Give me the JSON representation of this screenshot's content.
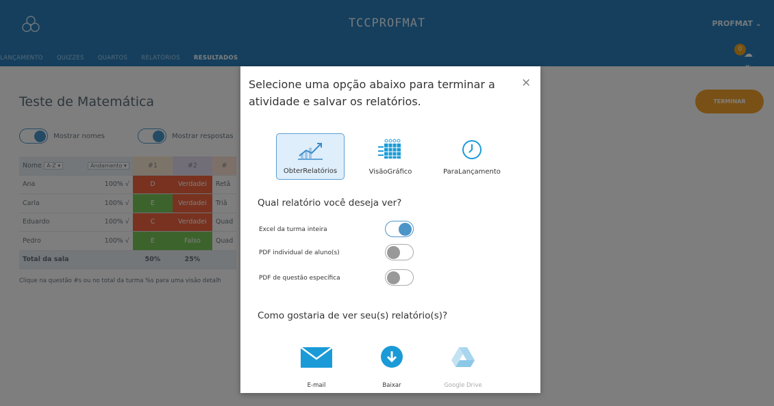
{
  "app": {
    "title": "TCCPROFMAT",
    "user": "PROFMAT ⌄"
  },
  "nav": {
    "items": [
      "LANÇAMENTO",
      "QUIZZES",
      "QUARTOS",
      "RELATÓRIOS"
    ],
    "active": "RESULTADOS"
  },
  "notifications": {
    "count": "0"
  },
  "page": {
    "title": "Teste de Matemática",
    "finish_label": "TERMINAR",
    "toggle_names": "Mostrar nomes",
    "toggle_answers": "Mostrar respostas",
    "hint": "Clique na questão #s ou no total da turma %s para uma visão detalh"
  },
  "table": {
    "name_header": "Nome",
    "sort_label": "A-Z ▾",
    "progress_header": "Andamento ▾",
    "questions": [
      "#1",
      "#2",
      "#"
    ],
    "rows": [
      {
        "name": "Ana",
        "pct": "100% √",
        "q1": "D",
        "q2": "Verdadei",
        "q3": "Retâ"
      },
      {
        "name": "Carla",
        "pct": "100% √",
        "q1": "E",
        "q2": "Verdadei",
        "q3": "Triâ"
      },
      {
        "name": "Eduardo",
        "pct": "100% √",
        "q1": "C",
        "q2": "Verdadei",
        "q3": "Quad"
      },
      {
        "name": "Pedro",
        "pct": "100% √",
        "q1": "E",
        "q2": "Falso",
        "q3": "Quad"
      }
    ],
    "total": {
      "label": "Total da sala",
      "q1": "50%",
      "q2": "25%"
    }
  },
  "modal": {
    "title": "Selecione uma opção abaixo para terminar a atividade e salvar os relatórios.",
    "close": "×",
    "options": [
      "ObterRelatórios",
      "VisãoGráfico",
      "ParaLançamento"
    ],
    "report_question": "Qual relatório você deseja ver?",
    "reports": [
      {
        "label": "Excel da turma inteira",
        "on": true
      },
      {
        "label": "PDF individual de aluno(s)",
        "on": false
      },
      {
        "label": "PDF de questão específica",
        "on": false
      }
    ],
    "delivery_question": "Como gostaria de ver seu(s) relatório(s)?",
    "destinations": [
      "E-mail",
      "Baixar",
      "Google Drive"
    ]
  },
  "colors": {
    "primary": "#2b7fba",
    "accent": "#f2a22c",
    "wrong": "#f0653f",
    "right": "#7bc65a"
  }
}
